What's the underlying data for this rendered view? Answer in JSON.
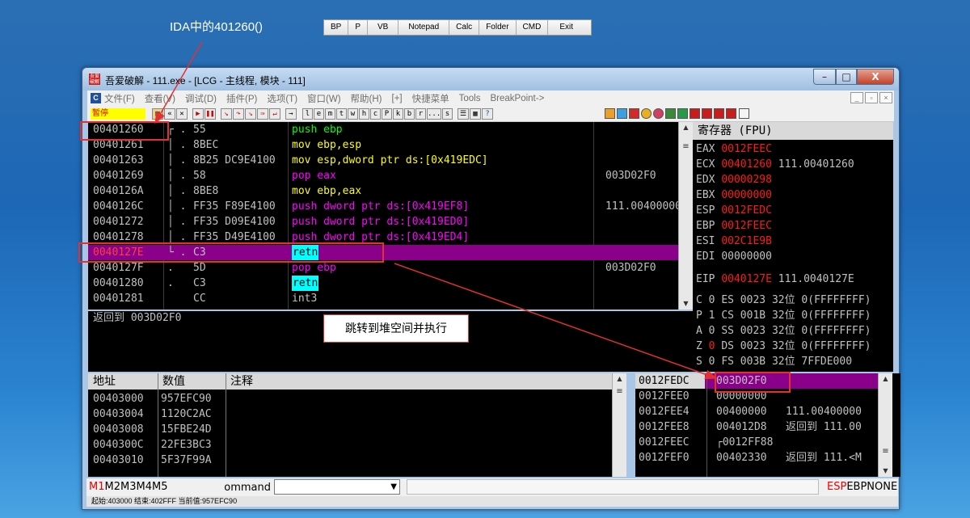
{
  "annotations": {
    "top_label": "IDA中的401260()",
    "jump_label": "跳转到堆空间并执行"
  },
  "top_toolbar": [
    "BP",
    "P",
    "VB",
    "Notepad",
    "Calc",
    "Folder",
    "CMD",
    "Exit"
  ],
  "window": {
    "title": "吾爱破解 - 111.exe - [LCG - 主线程, 模块 - 111]",
    "icon_text": "吾爱破解",
    "min_label": "–",
    "max_label": "□",
    "close_label": "X"
  },
  "menu": {
    "items": [
      "文件(F)",
      "查看(V)",
      "调试(D)",
      "插件(P)",
      "选项(T)",
      "窗口(W)",
      "帮助(H)",
      "[+]",
      "快捷菜单",
      "Tools",
      "BreakPoint->"
    ],
    "icon_letter": "C"
  },
  "toolbar": {
    "status": "暂停",
    "letters": [
      "l",
      "e",
      "m",
      "t",
      "w",
      "h",
      "c",
      "P",
      "k",
      "b",
      "r",
      "...",
      "s"
    ]
  },
  "disasm": {
    "rows": [
      {
        "addr": "00401260",
        "flag": "┌ .",
        "hex": "55",
        "ins": "push ebp",
        "cmt": "",
        "ins_color": "#00ff00",
        "selected": false
      },
      {
        "addr": "00401261",
        "flag": "│ .",
        "hex": "8BEC",
        "ins": "mov ebp,esp",
        "cmt": "",
        "ins_color": "#ffff00",
        "selected": false
      },
      {
        "addr": "00401263",
        "flag": "│ .",
        "hex": "8B25 DC9E4100",
        "ins": "mov esp,dword ptr ds:[0x419EDC]",
        "cmt": "",
        "ins_color": "#ffff00",
        "selected": false
      },
      {
        "addr": "00401269",
        "flag": "│ .",
        "hex": "58",
        "ins": "pop eax",
        "cmt": "003D02F0",
        "ins_color": "#ff00ff",
        "selected": false
      },
      {
        "addr": "0040126A",
        "flag": "│ .",
        "hex": "8BE8",
        "ins": "mov ebp,eax",
        "cmt": "",
        "ins_color": "#ffff00",
        "selected": false
      },
      {
        "addr": "0040126C",
        "flag": "│ .",
        "hex": "FF35 F89E4100",
        "ins": "push dword ptr ds:[0x419EF8]",
        "cmt": "111.00400000",
        "ins_color": "#ff00ff",
        "selected": false
      },
      {
        "addr": "00401272",
        "flag": "│ .",
        "hex": "FF35 D09E4100",
        "ins": "push dword ptr ds:[0x419ED0]",
        "cmt": "",
        "ins_color": "#ff00ff",
        "selected": false
      },
      {
        "addr": "00401278",
        "flag": "│ .",
        "hex": "FF35 D49E4100",
        "ins": "push dword ptr ds:[0x419ED4]",
        "cmt": "",
        "ins_color": "#ff00ff",
        "selected": false
      },
      {
        "addr": "0040127E",
        "flag": "└ .",
        "hex": "C3",
        "ins": "retn",
        "cmt": "",
        "ins_color": "#000000",
        "selected": true
      },
      {
        "addr": "0040127F",
        "flag": "  .",
        "hex": "5D",
        "ins": "pop ebp",
        "cmt": "003D02F0",
        "ins_color": "#ff00ff",
        "selected": false
      },
      {
        "addr": "00401280",
        "flag": "  .",
        "hex": "C3",
        "ins": "retn",
        "cmt": "",
        "ins_color": "#000000",
        "selected": false
      },
      {
        "addr": "00401281",
        "flag": "",
        "hex": "CC",
        "ins": "int3",
        "cmt": "",
        "ins_color": "#c0c0c0",
        "selected": false
      }
    ]
  },
  "info": {
    "text": "返回到 003D02F0"
  },
  "registers": {
    "title": "寄存器 (FPU)",
    "rows": [
      {
        "name": "EAX",
        "value": "0012FEEC",
        "extra": ""
      },
      {
        "name": "ECX",
        "value": "00401260",
        "extra": "111.00401260"
      },
      {
        "name": "EDX",
        "value": "00000298",
        "extra": ""
      },
      {
        "name": "EBX",
        "value": "00000000",
        "extra": ""
      },
      {
        "name": "ESP",
        "value": "0012FEDC",
        "extra": ""
      },
      {
        "name": "EBP",
        "value": "0012FEEC",
        "extra": ""
      },
      {
        "name": "ESI",
        "value": "002C1E9B",
        "extra": ""
      },
      {
        "name": "EDI",
        "value": "00000000",
        "extra": ""
      }
    ],
    "eip": {
      "name": "EIP",
      "value": "0040127E",
      "extra": "111.0040127E"
    },
    "seg": [
      {
        "flag": "C",
        "bit": "0",
        "seg": "ES",
        "sel": "0023",
        "info": "32位 0(FFFFFFFF)"
      },
      {
        "flag": "P",
        "bit": "1",
        "seg": "CS",
        "sel": "001B",
        "info": "32位 0(FFFFFFFF)"
      },
      {
        "flag": "A",
        "bit": "0",
        "seg": "SS",
        "sel": "0023",
        "info": "32位 0(FFFFFFFF)"
      },
      {
        "flag": "Z",
        "bit": "0",
        "seg": "DS",
        "sel": "0023",
        "info": "32位 0(FFFFFFFF)"
      },
      {
        "flag": "S",
        "bit": "0",
        "seg": "FS",
        "sel": "003B",
        "info": "32位 7FFDE000"
      }
    ]
  },
  "dump": {
    "headers": [
      "地址",
      "数值",
      "注释"
    ],
    "rows": [
      {
        "addr": "00403000",
        "val": "957EFC90"
      },
      {
        "addr": "00403004",
        "val": "1120C2AC"
      },
      {
        "addr": "00403008",
        "val": "15FBE24D"
      },
      {
        "addr": "0040300C",
        "val": "22FE3BC3"
      },
      {
        "addr": "00403010",
        "val": "5F37F99A"
      }
    ]
  },
  "stack": {
    "rows": [
      {
        "addr": "0012FEDC",
        "val": "003D02F0",
        "cmt": "",
        "selected": true
      },
      {
        "addr": "0012FEE0",
        "val": "00000000",
        "cmt": "",
        "selected": false
      },
      {
        "addr": "0012FEE4",
        "val": "00400000",
        "cmt": "111.00400000",
        "selected": false
      },
      {
        "addr": "0012FEE8",
        "val": "004012D8",
        "cmt": "返回到 111.00",
        "selected": false
      },
      {
        "addr": "0012FEEC",
        "val": "┌0012FF88",
        "cmt": "",
        "selected": false
      },
      {
        "addr": "0012FEF0",
        "val": "00402330",
        "cmt": "返回到 111.<M",
        "selected": false
      }
    ]
  },
  "cmdbar": {
    "tabs": [
      "M1",
      "M2",
      "M3",
      "M4",
      "M5"
    ],
    "command_label": "Command",
    "right_labels": [
      "ESP",
      "EBP",
      "NONE"
    ]
  },
  "statusbar": {
    "text": "起始:403000 结束:402FFF 当前值:957EFC90"
  }
}
